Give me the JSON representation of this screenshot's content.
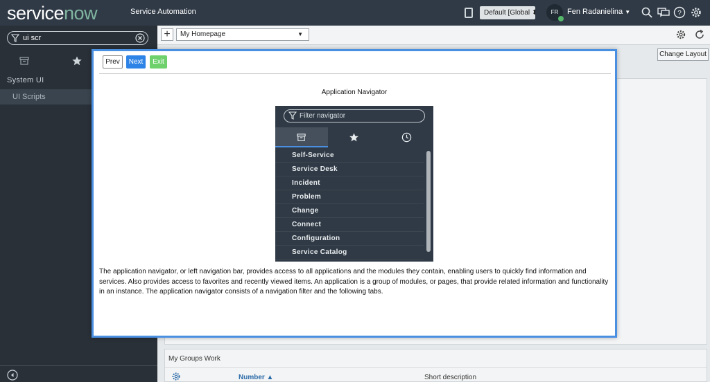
{
  "banner": {
    "logo_service": "service",
    "logo_now": "now",
    "title": "Service Automation",
    "scope": "Default [Global",
    "user_initials": "FR",
    "user_name": "Fen Radanielina"
  },
  "nav": {
    "filter_value": "ui scr",
    "application": "System UI",
    "module": "UI Scripts"
  },
  "toolbar": {
    "add_label": "+",
    "homepage": "My Homepage",
    "change_layout": "Change Layout"
  },
  "groups_widget": {
    "title": "My Groups Work",
    "col_number": "Number ▲",
    "col_short_description": "Short description"
  },
  "modal": {
    "prev": "Prev",
    "next": "Next",
    "exit": "Exit",
    "title": "Application Navigator",
    "image": {
      "filter_placeholder": "Filter navigator",
      "items": [
        "Self-Service",
        "Service Desk",
        "Incident",
        "Problem",
        "Change",
        "Connect",
        "Configuration",
        "Service Catalog"
      ]
    },
    "description": "The application navigator, or left navigation bar, provides access to all applications and the modules they contain, enabling users to quickly find information and services. Also provides access to favorites and recently viewed items. An application is a group of modules, or pages, that provide related information and functionality in an instance. The application navigator consists of a navigation filter and the following tabs."
  },
  "colors": {
    "banner": "#303a46",
    "nav": "#293038",
    "accent_blue": "#2e84e6",
    "exit_green": "#6ed16c",
    "modal_border": "#4a90e2",
    "logo_now": "#81b5a1"
  }
}
